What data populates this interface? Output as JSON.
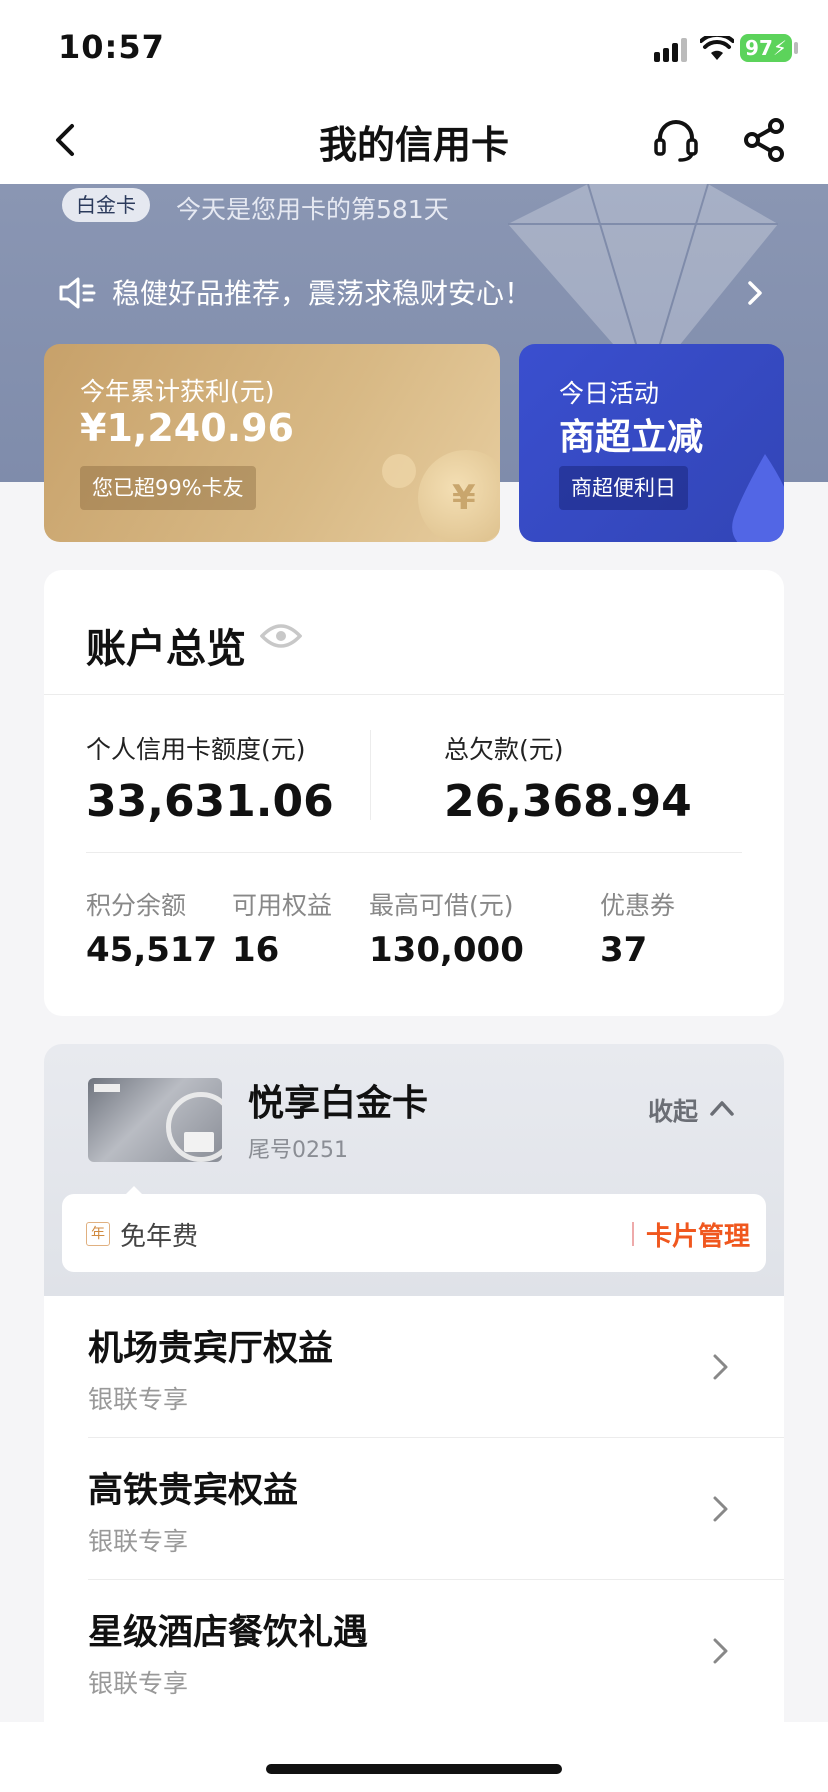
{
  "status_bar": {
    "time": "10:57",
    "battery": "97"
  },
  "nav": {
    "title": "我的信用卡"
  },
  "hero": {
    "card_badge": "白金卡",
    "days_text": "今天是您用卡的第581天",
    "announcement": "稳健好品推荐，震荡求稳财安心！"
  },
  "earnings_card": {
    "label": "今年累计获利(元)",
    "amount": "¥1,240.96",
    "pill": "您已超99%卡友"
  },
  "activity_card": {
    "label": "今日活动",
    "headline": "商超立减",
    "pill": "商超便利日"
  },
  "overview": {
    "title": "账户总览",
    "credit_limit_label": "个人信用卡额度(元)",
    "credit_limit_value": "33,631.06",
    "total_debt_label": "总欠款(元)",
    "total_debt_value": "26,368.94",
    "stats": [
      {
        "label": "积分余额",
        "value": "45,517"
      },
      {
        "label": "可用权益",
        "value": "16"
      },
      {
        "label": "最高可借(元)",
        "value": "130,000"
      },
      {
        "label": "优惠券",
        "value": "37"
      }
    ]
  },
  "card": {
    "name": "悦享白金卡",
    "tail": "尾号0251",
    "collapse": "收起",
    "fee_tag": "年",
    "fee": "免年费",
    "manage": "卡片管理"
  },
  "benefits": [
    {
      "title": "机场贵宾厅权益",
      "subtitle": "银联专享"
    },
    {
      "title": "高铁贵宾权益",
      "subtitle": "银联专享"
    },
    {
      "title": "星级酒店餐饮礼遇",
      "subtitle": "银联专享"
    }
  ],
  "colors": {
    "accent_orange": "#f0571e",
    "gold": "#c7a16a",
    "blue": "#3a4fcf",
    "hero": "#8a96b3"
  }
}
